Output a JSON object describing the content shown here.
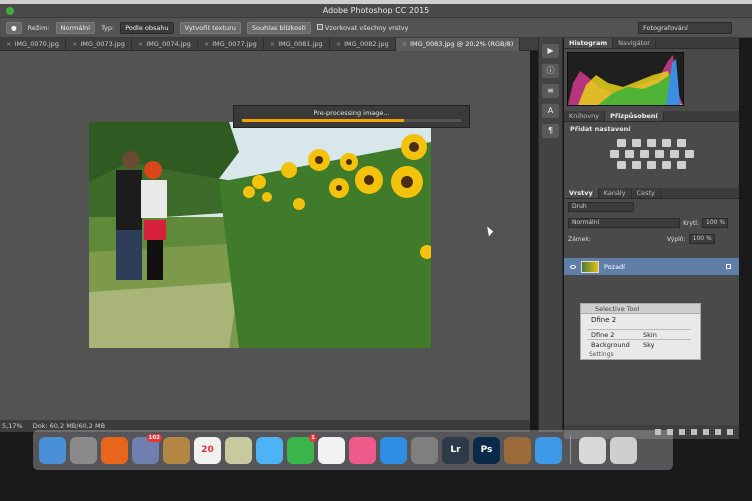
{
  "window": {
    "title": "Adobe Photoshop CC 2015"
  },
  "options_bar": {
    "mode_label": "Režim:",
    "mode_value": "Normální",
    "type_label": "Typ:",
    "type_options": [
      "Podle obsahu",
      "Vytvořit texturu",
      "Souhlas blízkosti"
    ],
    "sample_all_layers": "Vzorkovat všechny vrstvy",
    "workspace_select": "Fotografování"
  },
  "tabs": [
    {
      "label": "IMG_0070.jpg"
    },
    {
      "label": "IMG_0073.jpg"
    },
    {
      "label": "IMG_0074.jpg"
    },
    {
      "label": "IMG_0077.jpg"
    },
    {
      "label": "IMG_0081.jpg"
    },
    {
      "label": "IMG_0082.jpg"
    },
    {
      "label": "IMG_0083.jpg @ 20,2% (RGB/8)"
    }
  ],
  "progress": {
    "text": "Pre-processing image...",
    "fraction": 0.74,
    "color": "#f1a400"
  },
  "status": {
    "zoom": "5,17%",
    "doc": "Dok: 60,2 MB/60,2 MB"
  },
  "panels": {
    "histogram_tabs": [
      "Histogram",
      "Navigátor"
    ],
    "adjust_tabs": [
      "Knihovny",
      "Přizpůsobení"
    ],
    "adjust_heading": "Přidat nastavení",
    "layers_tabs": [
      "Vrstvy",
      "Kanály",
      "Cesty"
    ],
    "layers_filter": "Druh",
    "blend_mode": "Normální",
    "opacity_label": "Krytí:",
    "opacity_value": "100 %",
    "lock_label": "Zámek:",
    "fill_label": "Výplň:",
    "fill_value": "100 %",
    "layer_name": "Pozadí"
  },
  "selective_tool": {
    "title": "Selective Tool",
    "subtitle": "Dfine 2",
    "rows": [
      {
        "a": "Dfine 2",
        "b": "Skin"
      },
      {
        "a": "Background",
        "b": "Sky"
      }
    ],
    "footer": "Settings"
  },
  "dock": {
    "apps": [
      {
        "name": "finder-icon",
        "label": "",
        "color": "#4a90d9"
      },
      {
        "name": "launchpad-icon",
        "label": "",
        "color": "#8a8a8a"
      },
      {
        "name": "firefox-icon",
        "label": "",
        "color": "#e8651c"
      },
      {
        "name": "preview-icon",
        "label": "",
        "color": "#6f7fb0",
        "badge": "102"
      },
      {
        "name": "contacts-icon",
        "label": "",
        "color": "#b38643"
      },
      {
        "name": "calendar-icon",
        "label": "20",
        "color": "#f1f1f1"
      },
      {
        "name": "notes-icon",
        "label": "",
        "color": "#c9c9a0"
      },
      {
        "name": "messages-icon",
        "label": "",
        "color": "#4db3f5"
      },
      {
        "name": "facetime-icon",
        "label": "",
        "color": "#3ab54a",
        "badge": "1"
      },
      {
        "name": "photos-icon",
        "label": "",
        "color": "#f2f2f2"
      },
      {
        "name": "itunes-icon",
        "label": "",
        "color": "#f05a8a"
      },
      {
        "name": "app-store-icon",
        "label": "",
        "color": "#2f8de4"
      },
      {
        "name": "system-preferences-icon",
        "label": "",
        "color": "#7f7f7f"
      },
      {
        "name": "lightroom-icon",
        "label": "Lr",
        "color": "#2b3b4a"
      },
      {
        "name": "photoshop-icon",
        "label": "Ps",
        "color": "#0b2a4a"
      },
      {
        "name": "automator-icon",
        "label": "",
        "color": "#9b6b3a"
      },
      {
        "name": "safari-icon",
        "label": "",
        "color": "#3d9ae8"
      }
    ],
    "trash": [
      {
        "name": "downloads-stack-icon",
        "color": "#d8d8d8"
      },
      {
        "name": "trash-icon",
        "color": "#cfcfcf"
      }
    ]
  }
}
